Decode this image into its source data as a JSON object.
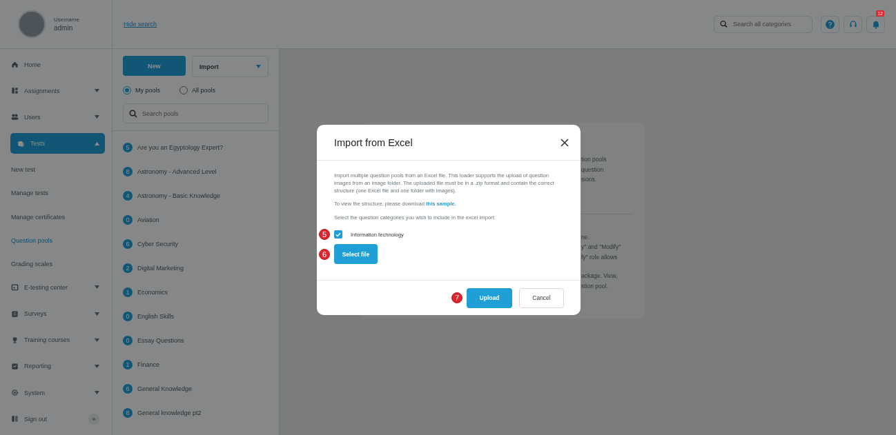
{
  "user": {
    "caption": "Username",
    "name": "admin"
  },
  "header": {
    "hide_search_link": "Hide search",
    "search": {
      "placeholder": "Search all categories"
    },
    "notifications_badge": "12"
  },
  "sidebar": {
    "items": [
      {
        "label": "Home",
        "selected": false
      },
      {
        "label": "Assignments",
        "expanded": false,
        "selected": false
      },
      {
        "label": "Users",
        "expanded": false,
        "selected": false
      },
      {
        "label": "Tests",
        "expanded": true,
        "selected": true,
        "children": [
          {
            "label": "New test",
            "selected": false
          },
          {
            "label": "Manage tests",
            "selected": false
          },
          {
            "label": "Manage certificates",
            "selected": false
          },
          {
            "label": "Question pools",
            "selected": true
          },
          {
            "label": "Grading scales",
            "selected": false
          }
        ]
      },
      {
        "label": "E-testing center",
        "expanded": false,
        "selected": false
      },
      {
        "label": "Surveys",
        "expanded": false,
        "selected": false
      },
      {
        "label": "Training courses",
        "expanded": false,
        "selected": false
      },
      {
        "label": "Reporting",
        "expanded": false,
        "selected": false
      },
      {
        "label": "System",
        "expanded": false,
        "selected": false
      },
      {
        "label": "Sign out",
        "selected": false
      }
    ],
    "collapse_label": "«"
  },
  "pools": {
    "new_button": "New",
    "import_button": "Import",
    "filters": [
      {
        "label": "My pools",
        "selected": true
      },
      {
        "label": "All pools",
        "selected": false
      }
    ],
    "search": {
      "placeholder": "Search pools"
    },
    "items": [
      {
        "count": "5",
        "name": "Are you an Egyptology Expert?"
      },
      {
        "count": "8",
        "name": "Astronomy - Advanced Level"
      },
      {
        "count": "4",
        "name": "Astronomy - Basic Knowledge"
      },
      {
        "count": "0",
        "name": "Aviation"
      },
      {
        "count": "6",
        "name": "Cyber Security"
      },
      {
        "count": "2",
        "name": "Digital Marketing"
      },
      {
        "count": "1",
        "name": "Economics"
      },
      {
        "count": "0",
        "name": "English Skills"
      },
      {
        "count": "0",
        "name": "Essay Questions"
      },
      {
        "count": "1",
        "name": "Finance"
      },
      {
        "count": "6",
        "name": "General Knowledge"
      },
      {
        "count": "8",
        "name": "General knowledge pt2"
      }
    ]
  },
  "background_card": {
    "lines": [
      "tion pools",
      "question",
      "sions.",
      "ne.",
      "y\" and \"Modify\"",
      "fy\" role allows",
      "ackage. View,",
      "stion pool."
    ]
  },
  "dialog": {
    "title": "Import from Excel",
    "description": "Import multiple question pools from an Excel file. This loader supports the upload of question images from an image folder. The uploaded file must be in a .zip format and contain the correct structure (one Excel file and one folder with images).",
    "sample_text": "To view the structure, please download",
    "sample_link": "this sample.",
    "categories_prompt": "Select the question categories you wish to include in the excel import:",
    "categories": [
      {
        "label": "Information technology",
        "checked": true,
        "step": "5"
      }
    ],
    "select_file": {
      "label": "Select file",
      "step": "6"
    },
    "upload": {
      "label": "Upload",
      "step": "7"
    },
    "cancel": "Cancel"
  }
}
